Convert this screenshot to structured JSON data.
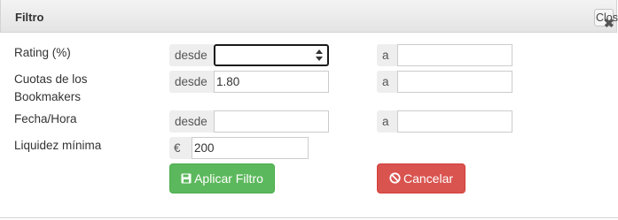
{
  "dialog": {
    "title": "Filtro",
    "close_label": "Clos"
  },
  "rows": [
    {
      "label": "Rating (%)",
      "from_label": "desde",
      "from_value": "",
      "to_label": "a",
      "to_value": ""
    },
    {
      "label_line1": "Cuotas de los",
      "label_line2": "Bookmakers",
      "from_label": "desde",
      "from_value": "1.80",
      "to_label": "a",
      "to_value": ""
    },
    {
      "label": "Fecha/Hora",
      "from_label": "desde",
      "from_value": "",
      "to_label": "a",
      "to_value": ""
    }
  ],
  "liquidity": {
    "label": "Liquidez mínima",
    "currency": "€",
    "value": "200"
  },
  "buttons": {
    "apply": "Aplicar Filtro",
    "cancel": "Cancelar"
  },
  "icons": {
    "close": "close-icon",
    "apply": "save-icon",
    "cancel": "ban-icon"
  },
  "colors": {
    "apply_bg": "#5cb85c",
    "cancel_bg": "#d9534f"
  }
}
